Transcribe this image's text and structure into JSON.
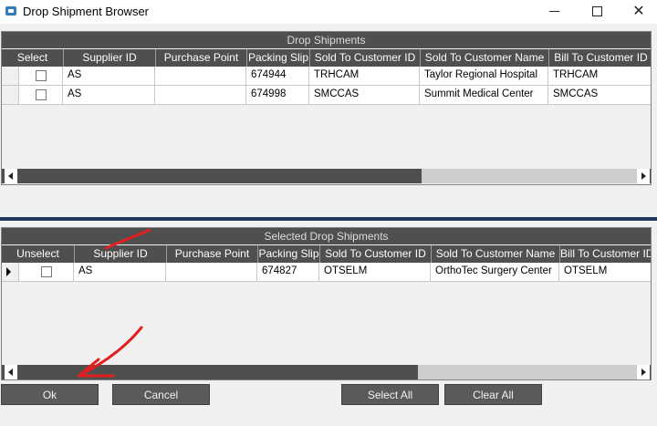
{
  "window": {
    "title": "Drop Shipment Browser",
    "minimize_label": "–",
    "maximize_label": "☐",
    "close_label": "✕"
  },
  "drop_shipments": {
    "caption": "Drop Shipments",
    "columns": [
      "Select",
      "Supplier ID",
      "Purchase Point",
      "Packing Slip",
      "Sold To Customer ID",
      "Sold To Customer Name",
      "Bill To Customer ID"
    ],
    "rows": [
      {
        "supplier_id": "AS",
        "purchase_point": "",
        "packing_slip": "674944",
        "sold_to_id": "TRHCAM",
        "sold_to_name": "Taylor Regional Hospital",
        "bill_to_id": "TRHCAM"
      },
      {
        "supplier_id": "AS",
        "purchase_point": "",
        "packing_slip": "674998",
        "sold_to_id": "SMCCAS",
        "sold_to_name": "Summit Medical Center",
        "bill_to_id": "SMCCAS"
      }
    ]
  },
  "selected_drop_shipments": {
    "caption": "Selected Drop Shipments",
    "columns": [
      "Unselect",
      "Supplier ID",
      "Purchase Point",
      "Packing Slip",
      "Sold To Customer ID",
      "Sold To Customer Name",
      "Bill To Customer ID"
    ],
    "rows": [
      {
        "supplier_id": "AS",
        "purchase_point": "",
        "packing_slip": "674827",
        "sold_to_id": "OTSELM",
        "sold_to_name": "OrthoTec Surgery Center",
        "bill_to_id": "OTSELM"
      }
    ]
  },
  "buttons": {
    "ok": "Ok",
    "cancel": "Cancel",
    "select_all": "Select All",
    "clear_all": "Clear All"
  },
  "colors": {
    "header": "#4f4f4f",
    "splitter": "#1f3a5c",
    "annotation": "#e02020"
  }
}
